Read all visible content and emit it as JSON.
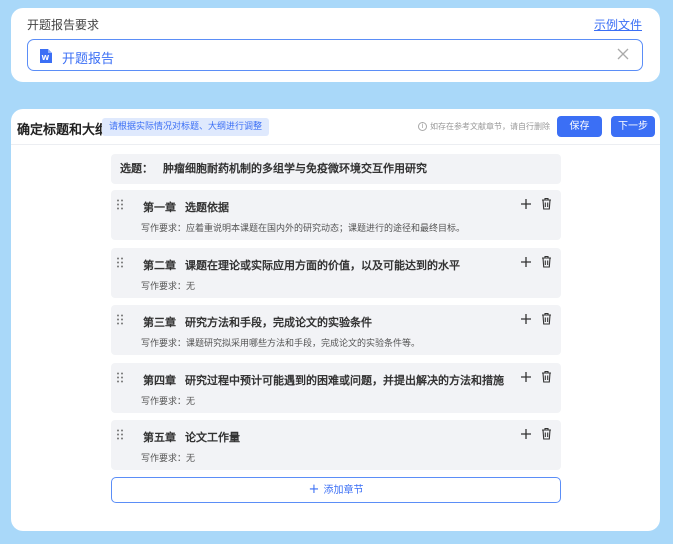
{
  "proposal": {
    "title": "开题报告要求",
    "example_link": "示例文件",
    "file_name": "开题报告",
    "file_icon": "word-doc-icon",
    "close_icon": "close-icon"
  },
  "outline": {
    "title": "确定标题和大纲",
    "hint": "请根据实际情况对标题、大纲进行调整",
    "note": "如存在参考文献章节，请自行删除",
    "save_label": "保存",
    "next_label": "下一步",
    "topic_label": "选题：",
    "topic": "肿瘤细胞耐药机制的多组学与免疫微环境交互作用研究",
    "chapters": [
      {
        "num": "第一章",
        "title": "选题依据",
        "req": "写作要求：应着重说明本课题在国内外的研究动态；课题进行的途径和最终目标。"
      },
      {
        "num": "第二章",
        "title": "课题在理论或实际应用方面的价值，以及可能达到的水平",
        "req": "写作要求：无"
      },
      {
        "num": "第三章",
        "title": "研究方法和手段，完成论文的实验条件",
        "req": "写作要求：课题研究拟采用哪些方法和手段，完成论文的实验条件等。"
      },
      {
        "num": "第四章",
        "title": "研究过程中预计可能遇到的困难或问题，并提出解决的方法和措施",
        "req": "写作要求：无"
      },
      {
        "num": "第五章",
        "title": "论文工作量",
        "req": "写作要求：无"
      }
    ],
    "add_section_label": "添加章节"
  },
  "colors": {
    "background": "#a9d8f9",
    "accent": "#3b6ff5",
    "chapter_bg": "#f2f3f6"
  }
}
